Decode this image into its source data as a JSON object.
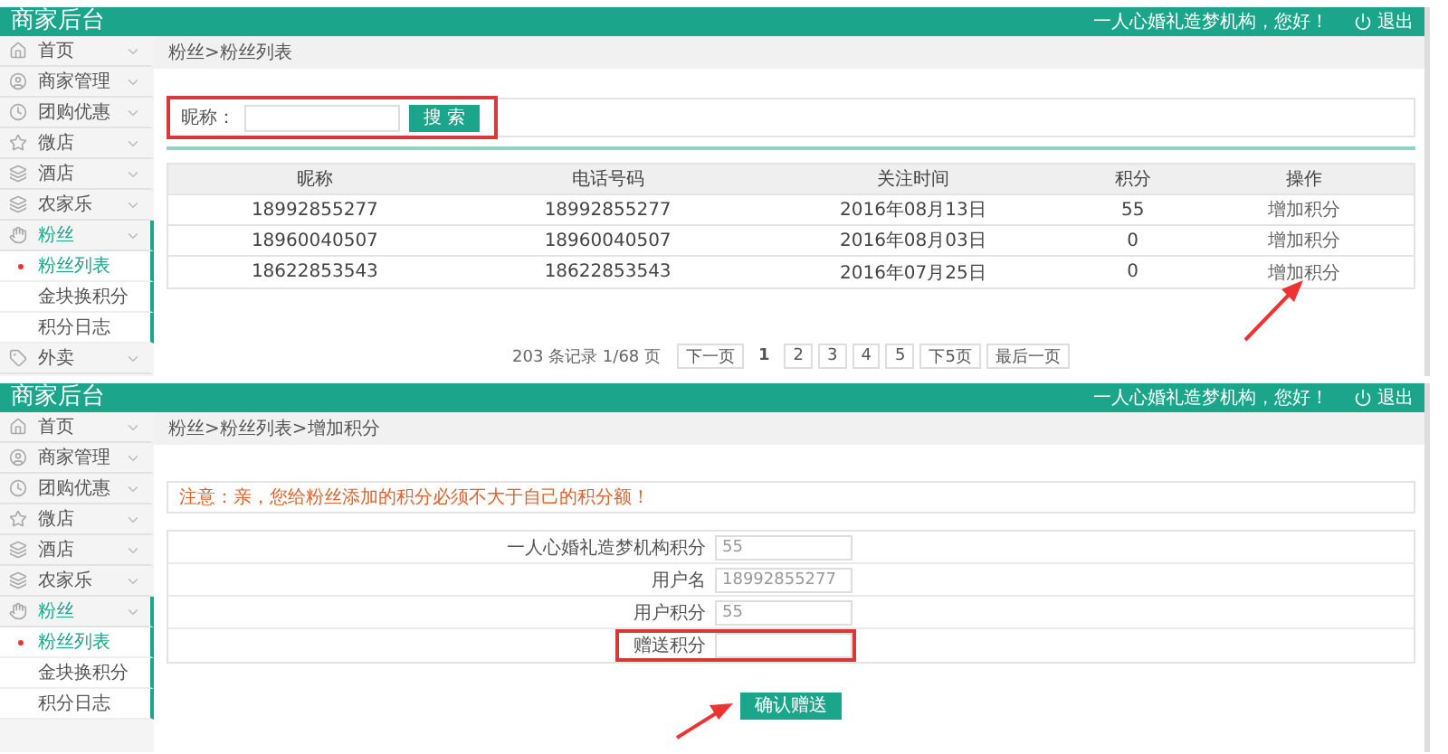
{
  "panels": [
    {
      "kind": "list",
      "header": {
        "title": "商家后台",
        "greeting": "一人心婚礼造梦机构，您好！",
        "logout": "退出"
      },
      "sidebar": {
        "items": [
          {
            "label": "首页",
            "selected": false
          },
          {
            "label": "商家管理",
            "selected": false
          },
          {
            "label": "团购优惠",
            "selected": false
          },
          {
            "label": "微店",
            "selected": false
          },
          {
            "label": "酒店",
            "selected": false
          },
          {
            "label": "农家乐",
            "selected": false
          },
          {
            "label": "粉丝",
            "selected": true,
            "expanded": true,
            "children": [
              {
                "label": "粉丝列表",
                "selected": true
              },
              {
                "label": "金块换积分",
                "selected": false
              },
              {
                "label": "积分日志",
                "selected": false
              }
            ]
          },
          {
            "label": "外卖",
            "selected": false
          }
        ]
      },
      "breadcrumb": "粉丝>粉丝列表",
      "search": {
        "label": "昵称：",
        "button": "搜 索",
        "highlighted": true
      },
      "table": {
        "columns": [
          "昵称",
          "电话号码",
          "关注时间",
          "积分",
          "操作"
        ],
        "rows": [
          {
            "cells": [
              "18992855277",
              "18992855277",
              "2016年08月13日",
              "55"
            ],
            "action": "增加积分"
          },
          {
            "cells": [
              "18960040507",
              "18960040507",
              "2016年08月03日",
              "0"
            ],
            "action": "增加积分"
          },
          {
            "cells": [
              "18622853543",
              "18622853543",
              "2016年07月25日",
              "0"
            ],
            "action": "增加积分"
          }
        ]
      },
      "pagination": {
        "summary": "203 条记录 1/68 页",
        "buttons": [
          {
            "label": "下一页",
            "selected": false
          },
          {
            "label": "1",
            "selected": true
          },
          {
            "label": "2",
            "selected": false
          },
          {
            "label": "3",
            "selected": false
          },
          {
            "label": "4",
            "selected": false
          },
          {
            "label": "5",
            "selected": false
          },
          {
            "label": "下5页",
            "selected": false
          },
          {
            "label": "最后一页",
            "selected": false
          }
        ]
      }
    },
    {
      "kind": "form",
      "header": {
        "title": "商家后台",
        "greeting": "一人心婚礼造梦机构，您好！",
        "logout": "退出"
      },
      "sidebar": {
        "items": [
          {
            "label": "首页",
            "selected": false
          },
          {
            "label": "商家管理",
            "selected": false
          },
          {
            "label": "团购优惠",
            "selected": false
          },
          {
            "label": "微店",
            "selected": false
          },
          {
            "label": "酒店",
            "selected": false
          },
          {
            "label": "农家乐",
            "selected": false
          },
          {
            "label": "粉丝",
            "selected": true,
            "expanded": true,
            "children": [
              {
                "label": "粉丝列表",
                "selected": true
              },
              {
                "label": "金块换积分",
                "selected": false
              },
              {
                "label": "积分日志",
                "selected": false
              }
            ]
          }
        ]
      },
      "breadcrumb": "粉丝>粉丝列表>增加积分",
      "notice": "注意：亲，您给粉丝添加的积分必须不大于自己的积分额！",
      "fields": [
        {
          "label": "一人心婚礼造梦机构积分",
          "value": "55",
          "disabled": true,
          "highlighted": false
        },
        {
          "label": "用户名",
          "value": "18992855277",
          "disabled": true,
          "highlighted": false
        },
        {
          "label": "用户积分",
          "value": "55",
          "disabled": true,
          "highlighted": false
        },
        {
          "label": "赠送积分",
          "disabled": false,
          "highlighted": true
        }
      ],
      "button": "确认赠送"
    }
  ]
}
